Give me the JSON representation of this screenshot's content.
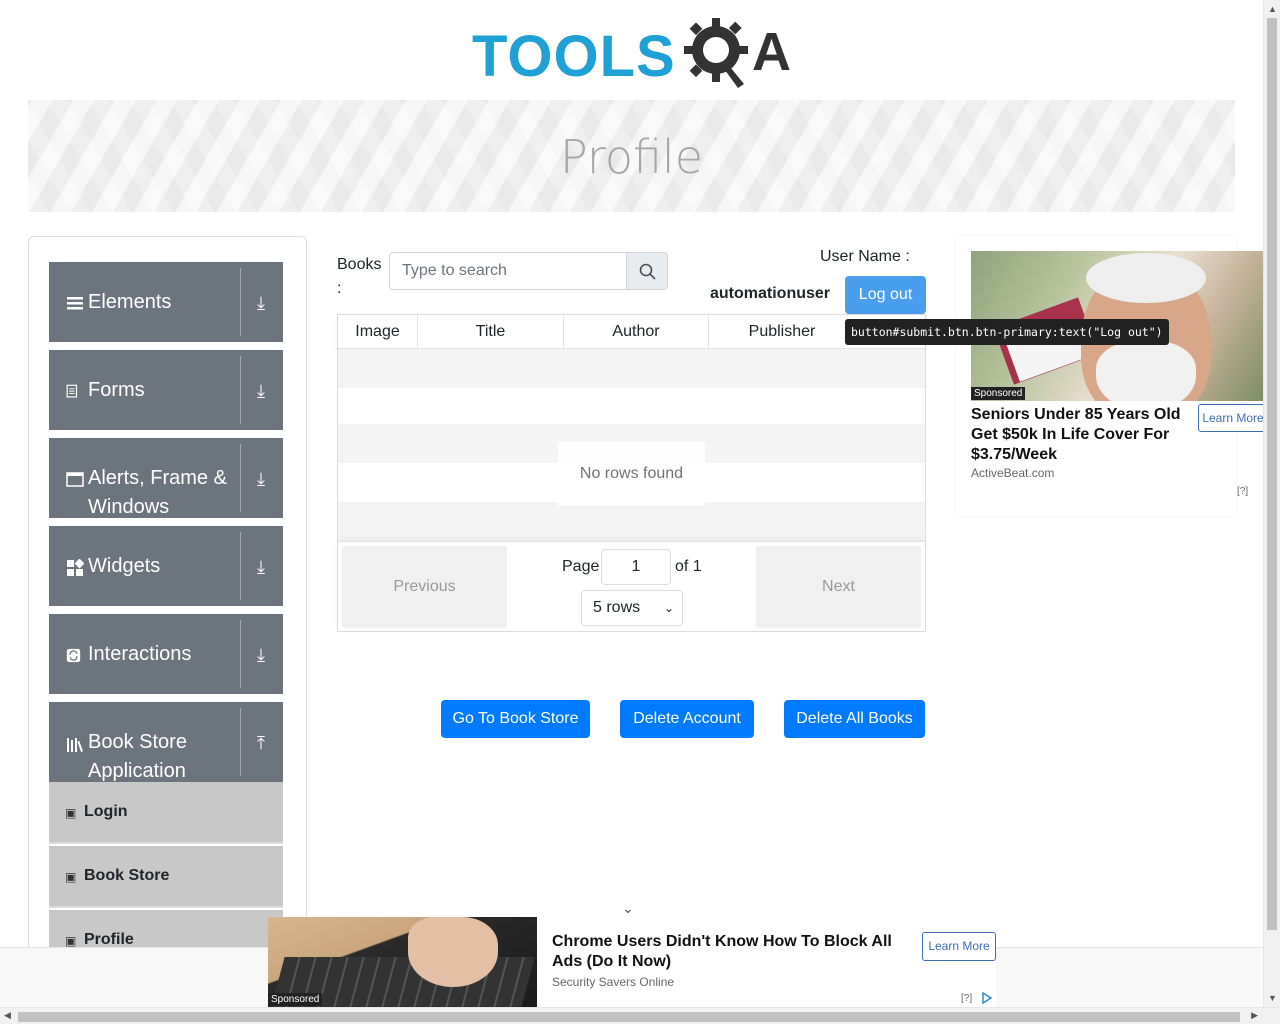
{
  "header": {
    "logo_text": "TOOLS",
    "logo_suffix": "A",
    "page_title": "Profile"
  },
  "sidebar": {
    "groups": [
      {
        "label": "Elements",
        "icon": "hamburger-icon",
        "state": "collapsed"
      },
      {
        "label": "Forms",
        "icon": "form-icon",
        "state": "collapsed"
      },
      {
        "label": "Alerts, Frame & Windows",
        "icon": "window-icon",
        "state": "collapsed"
      },
      {
        "label": "Widgets",
        "icon": "widgets-icon",
        "state": "collapsed"
      },
      {
        "label": "Interactions",
        "icon": "interactions-icon",
        "state": "collapsed"
      },
      {
        "label": "Book Store Application",
        "icon": "books-icon",
        "state": "expanded"
      }
    ],
    "book_store_items": [
      {
        "label": "Login"
      },
      {
        "label": "Book Store"
      },
      {
        "label": "Profile"
      }
    ]
  },
  "profile": {
    "books_label": "Books :",
    "search_placeholder": "Type to search",
    "username_label": "User Name :",
    "username_value": "automationuser",
    "logout_label": "Log out",
    "tooltip": "button#submit.btn.btn-primary:text(\"Log out\")"
  },
  "table": {
    "columns": [
      "Image",
      "Title",
      "Author",
      "Publisher"
    ],
    "empty_text": "No rows found",
    "previous_label": "Previous",
    "next_label": "Next",
    "page_label": "Page",
    "page_value": "1",
    "of_label": "of 1",
    "rows_select": "5 rows"
  },
  "actions": {
    "go_to_store": "Go To Book Store",
    "delete_account": "Delete Account",
    "delete_all_books": "Delete All Books"
  },
  "ad_right": {
    "sponsored": "Sponsored",
    "headline": "Seniors Under 85 Years Old Get $50k In Life Cover For $3.75/Week",
    "source": "ActiveBeat.com",
    "cta": "Learn More",
    "info": "[?]"
  },
  "ad_bottom": {
    "sponsored": "Sponsored",
    "headline": "Chrome Users Didn't Know How To Block All Ads (Do It Now)",
    "source": "Security Savers Online",
    "cta": "Learn More",
    "info": "[?]"
  },
  "colors": {
    "primary": "#007bff",
    "logout": "#4a9eee",
    "sidebar_group": "#6c757d",
    "sidebar_subitem": "#c8c8c8",
    "logo_blue": "#1fa1d5",
    "logo_dark": "#333333"
  }
}
